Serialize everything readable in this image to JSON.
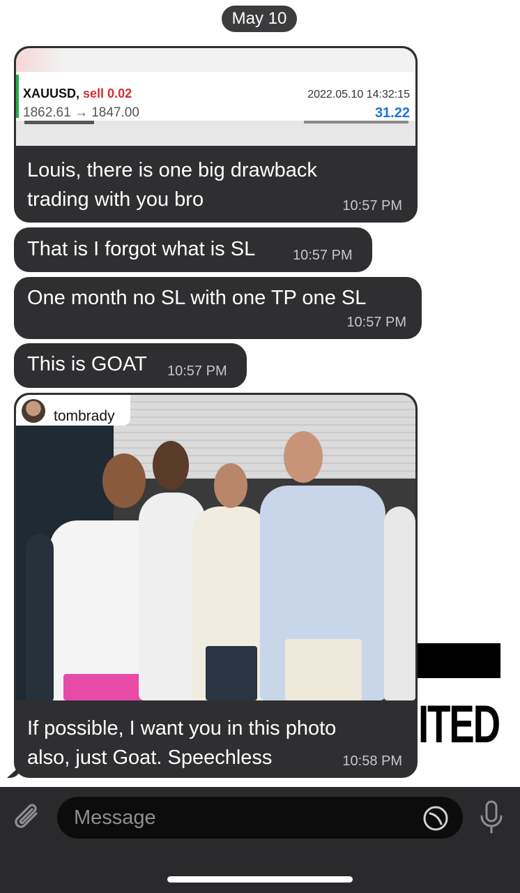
{
  "date_separator": "May 10",
  "messages": [
    {
      "trade_card": {
        "symbol": "XAUUSD,",
        "action": "sell 0.02",
        "datetime": "2022.05.10 14:32:15",
        "prices": "1862.61 → 1847.00",
        "profit": "31.22"
      },
      "line1": "Louis, there is one big drawback",
      "line2": "trading with you bro",
      "time": "10:57 PM"
    },
    {
      "text": "That is I forgot what is SL",
      "time": "10:57 PM"
    },
    {
      "text": "One month no SL with one TP one SL",
      "time": "10:57 PM"
    },
    {
      "text": "This is GOAT",
      "time": "10:57 PM"
    },
    {
      "photo_tag": "tombrady",
      "line1": "If possible, I want you in this photo",
      "line2": "also, just Goat. Speechless",
      "time": "10:58 PM"
    }
  ],
  "background_text": "ITED",
  "input": {
    "placeholder": "Message"
  },
  "icons": [
    "paperclip-icon",
    "sticker-icon",
    "microphone-icon"
  ],
  "colors": {
    "bubble": "#2f2f31",
    "sell": "#d62d2d",
    "profit": "#1f74d8",
    "input_bar": "#2a2a2c"
  }
}
